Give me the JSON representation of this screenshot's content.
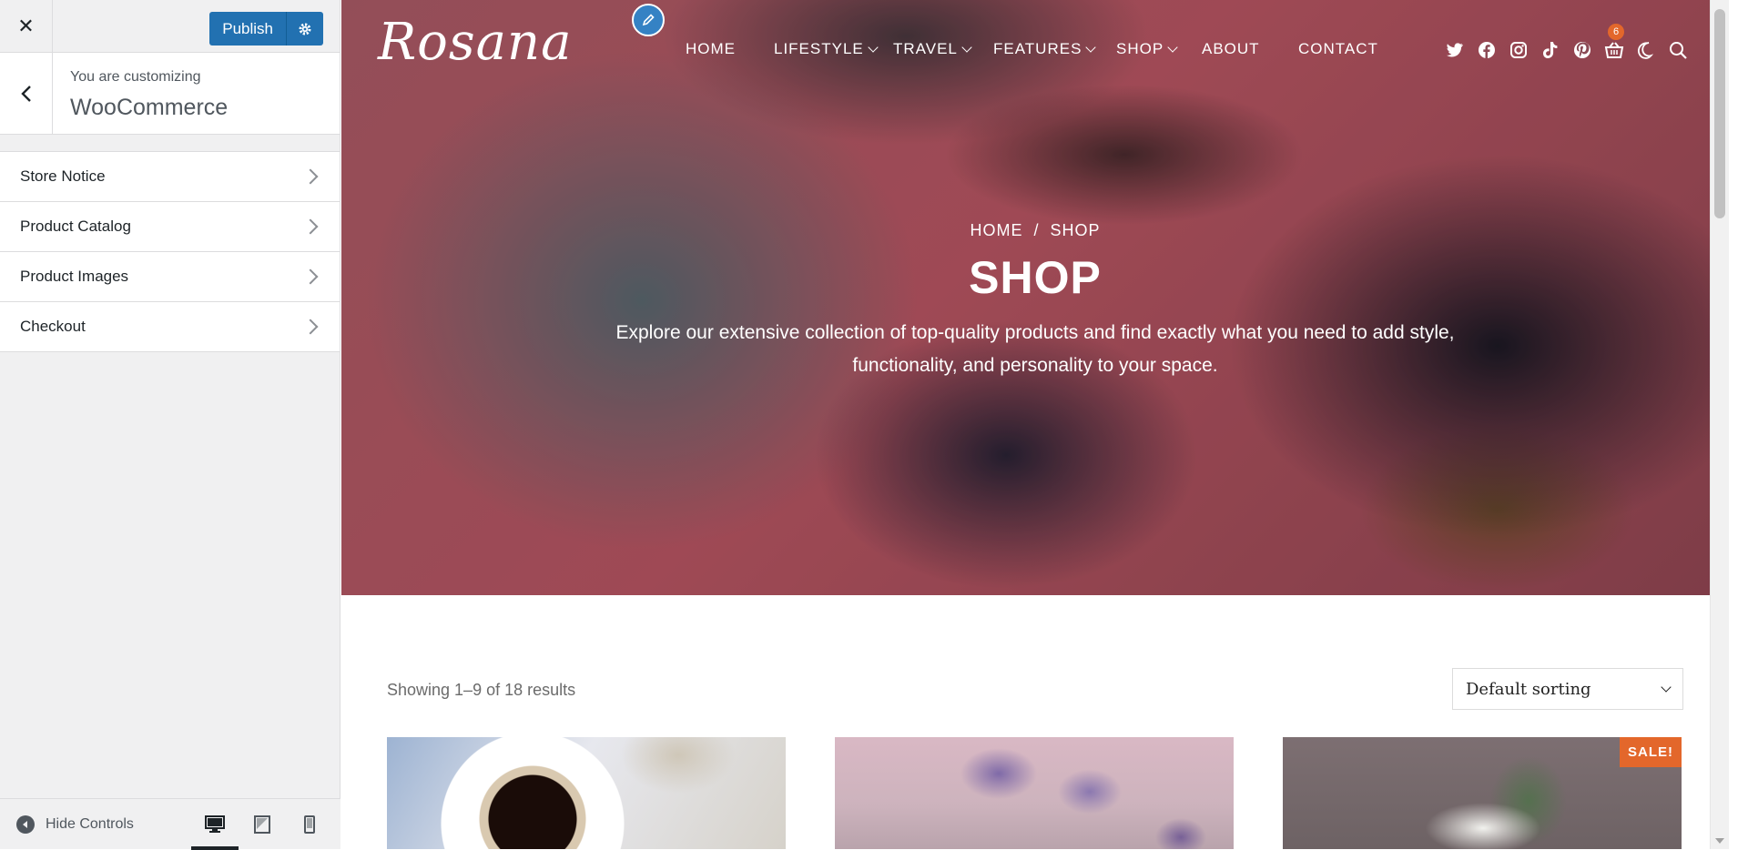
{
  "customizer": {
    "close_label": "✕",
    "publish_label": "Publish",
    "customizing_label": "You are customizing",
    "section_title": "WooCommerce",
    "sections": [
      {
        "label": "Store Notice"
      },
      {
        "label": "Product Catalog"
      },
      {
        "label": "Product Images"
      },
      {
        "label": "Checkout"
      }
    ],
    "hide_controls_label": "Hide Controls",
    "devices": [
      "desktop-icon",
      "tablet-icon",
      "mobile-icon"
    ],
    "active_device": "desktop-icon",
    "accent_color": "#2271b1"
  },
  "site": {
    "logo_text": "Rosana",
    "nav": [
      {
        "label": "HOME",
        "has_dropdown": false
      },
      {
        "label": "LIFESTYLE",
        "has_dropdown": true
      },
      {
        "label": "TRAVEL",
        "has_dropdown": true
      },
      {
        "label": "FEATURES",
        "has_dropdown": true
      },
      {
        "label": "SHOP",
        "has_dropdown": true
      },
      {
        "label": "ABOUT",
        "has_dropdown": false
      },
      {
        "label": "CONTACT",
        "has_dropdown": false
      }
    ],
    "social_icons": [
      "twitter-icon",
      "facebook-icon",
      "instagram-icon",
      "tiktok-icon",
      "pinterest-icon"
    ],
    "cart_count": "6",
    "badge_color": "#e3672b"
  },
  "hero": {
    "breadcrumb_home": "HOME",
    "breadcrumb_separator": "/",
    "breadcrumb_current": "SHOP",
    "title": "SHOP",
    "description": "Explore our extensive collection of top-quality products and find exactly what you need to add style, functionality, and personality to your space."
  },
  "shop": {
    "result_count": "Showing 1–9 of 18 results",
    "sort_value": "Default sorting",
    "sale_label": "SALE!"
  }
}
